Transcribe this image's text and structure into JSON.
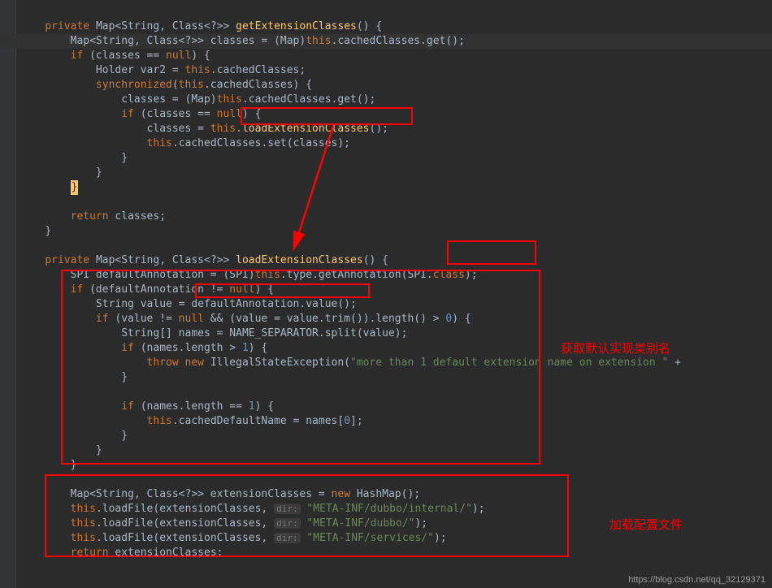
{
  "code": {
    "l1": {
      "kw_private": "private",
      "type": "Map<String, Class<?>>",
      "method": "getExtensionClasses",
      "tail": "() {"
    },
    "l2": {
      "p1": "Map<String, Class<?>> classes = (Map)",
      "kw_this": "this",
      "dot_field": ".cachedClasses.get();"
    },
    "l3": {
      "kw_if": "if",
      "cond": " (classes == ",
      "kw_null": "null",
      "close": ") {"
    },
    "l4": {
      "p1": "Holder var2 = ",
      "kw_this": "this",
      "dot": ".cachedClasses;"
    },
    "l5": {
      "kw_sync": "synchronized",
      "open": "(",
      "kw_this": "this",
      "field": ".cachedClasses) {"
    },
    "l6": {
      "p1": "classes = (Map)",
      "kw_this": "this",
      "tail": ".cachedClasses.get();"
    },
    "l7": {
      "kw_if": "if",
      "cond": " (classes == ",
      "kw_null": "null",
      "close": ") {"
    },
    "l8": {
      "p1": "classes = ",
      "kw_this": "this",
      "call": ".",
      "method": "loadExtensionClasses",
      "tail": "();"
    },
    "l9": {
      "kw_this": "this",
      "tail": ".cachedClasses.set(classes);"
    },
    "l10": {
      "brace": "}"
    },
    "l11": {
      "brace": "}"
    },
    "l12": {
      "brace": "}"
    },
    "l13": {
      "kw_ret": "return",
      "tail": " classes;"
    },
    "l14": {
      "brace": "}"
    },
    "l15": {
      "kw_private": "private",
      "type": "Map<String, Class<?>>",
      "method": "loadExtensionClasses",
      "tail": "() {"
    },
    "l16": {
      "p1": "SPI defaultAnnotation = (SPI)",
      "kw_this": "this",
      "p2": ".type.getAnnotation(SPI.",
      "kw_class": "class",
      "tail": ");"
    },
    "l17": {
      "kw_if": "if",
      "p1": " (defaultAnnotation != ",
      "kw_null": "null",
      "tail": ") {"
    },
    "l18": {
      "p1": "String value = ",
      "call": "defaultAnnotation.value()",
      "tail": ";"
    },
    "l19": {
      "kw_if": "if",
      "p1": " (value != ",
      "kw_null": "null",
      "p2": " && (value = value.trim()).length() > ",
      "num": "0",
      "tail": ") {"
    },
    "l20": {
      "p1": "String[] names = NAME_SEPARATOR.split(value);"
    },
    "l21": {
      "kw_if": "if",
      "p1": " (names.length > ",
      "num": "1",
      "tail": ") {"
    },
    "l22": {
      "kw_throw": "throw new",
      "exc": " IllegalStateException(",
      "str": "\"more than 1 default extension name on extension \"",
      "tail": " + "
    },
    "l23": {
      "brace": "}"
    },
    "l24": {
      "kw_if": "if",
      "p1": " (names.length == ",
      "num": "1",
      "tail": ") {"
    },
    "l25": {
      "kw_this": "this",
      "p1": ".cachedDefaultName = names[",
      "num": "0",
      "tail": "];"
    },
    "l26": {
      "brace": "}"
    },
    "l27": {
      "brace": "}"
    },
    "l28": {
      "brace": "}"
    },
    "l29": {
      "p1": "Map<String, Class<?>> extensionClasses = ",
      "kw_new": "new",
      "ctor": " HashMap();"
    },
    "l30": {
      "kw_this": "this",
      "p1": ".loadFile(extensionClasses, ",
      "hint": "dir:",
      "str": " \"META-INF/dubbo/internal/\"",
      "tail": ");"
    },
    "l31": {
      "kw_this": "this",
      "p1": ".loadFile(extensionClasses, ",
      "hint": "dir:",
      "str": " \"META-INF/dubbo/\"",
      "tail": ");"
    },
    "l32": {
      "kw_this": "this",
      "p1": ".loadFile(extensionClasses, ",
      "hint": "dir:",
      "str": " \"META-INF/services/\"",
      "tail": ");"
    },
    "l33": {
      "kw_ret": "return",
      "tail": " extensionClasses;"
    }
  },
  "annotations": {
    "a1": "获取默认实现类别名",
    "a2": "加载配置文件"
  },
  "watermark": "https://blog.csdn.net/qq_32129371"
}
